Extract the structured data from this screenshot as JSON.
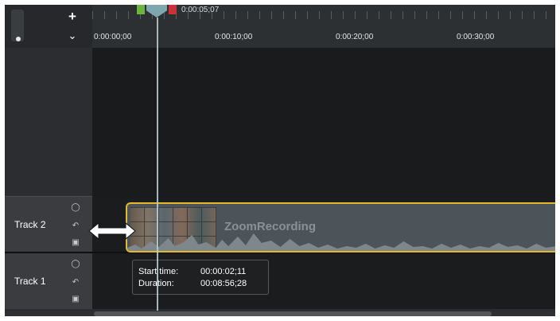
{
  "toolbar": {
    "add_track_icon": "plus-icon",
    "collapse_icon": "chevron-down-icon",
    "zoom_icon": "zoom-slider-icon"
  },
  "ruler": {
    "playhead_time": "0:00:05;07",
    "tick_labels": [
      "0:00:00;00",
      "0:00:10;00",
      "0:00:20;00",
      "0:00:30;00"
    ]
  },
  "tracks": [
    {
      "name": "Track 2",
      "icons": [
        "eye-icon",
        "magnet-icon",
        "lock-icon"
      ]
    },
    {
      "name": "Track 1",
      "icons": [
        "eye-icon",
        "magnet-icon",
        "lock-icon"
      ]
    }
  ],
  "clip": {
    "label": "ZoomRecording"
  },
  "tooltip": {
    "start_label": "Start time:",
    "start_value": "00:00:02;11",
    "duration_label": "Duration:",
    "duration_value": "00:08:56;28"
  },
  "colors": {
    "clip_border": "#e7b829",
    "in_marker": "#6db33f",
    "out_marker": "#c8323a",
    "playhead": "#7ea8ad"
  }
}
